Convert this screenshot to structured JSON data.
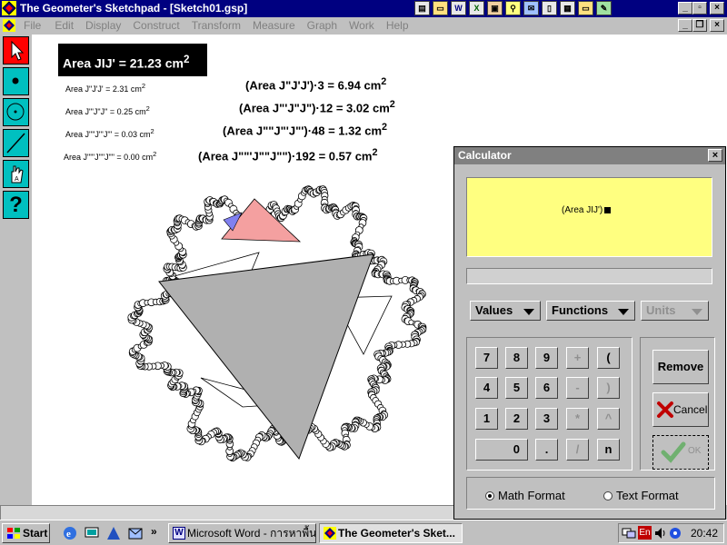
{
  "window": {
    "title": "The Geometer's Sketchpad - [Sketch01.gsp]"
  },
  "menubar": {
    "items": [
      "File",
      "Edit",
      "Display",
      "Construct",
      "Transform",
      "Measure",
      "Graph",
      "Work",
      "Help"
    ]
  },
  "toolbar_icons": [
    "notepad-icon",
    "open-folder-icon",
    "word-icon",
    "excel-icon",
    "powerpoint-icon",
    "search-icon",
    "mail-icon",
    "document-icon",
    "calculator-icon",
    "folder-icon",
    "paint-icon"
  ],
  "toolbox": {
    "tools": [
      "selection-arrow-tool-icon",
      "point-tool-icon",
      "compass-tool-icon",
      "straightedge-tool-icon",
      "text-hand-tool-icon",
      "help-tool-icon"
    ],
    "help_label": "?"
  },
  "measurements": {
    "main": {
      "label": "Area JIJ' = 21.23 cm",
      "sup": "2"
    },
    "small": [
      {
        "label": "Area J\"J'J' = 2.31 cm",
        "sup": "2"
      },
      {
        "label": "Area J\"'J\"J\" = 0.25 cm",
        "sup": "2"
      },
      {
        "label": "Area J\"\"J\"'J\"' = 0.03 cm",
        "sup": "2"
      },
      {
        "label": "Area J\"\"'J\"\"J\"\" = 0.00 cm",
        "sup": "2"
      }
    ],
    "computed": [
      {
        "label": "(Area J\"J'J')·3 = 6.94 cm",
        "sup": "2"
      },
      {
        "label": "(Area J\"'J\"J\")·12 = 3.02 cm",
        "sup": "2"
      },
      {
        "label": "(Area J\"\"J\"'J\"')·48 = 1.32 cm",
        "sup": "2"
      },
      {
        "label": "(Area J\"\"'J\"\"J\"\")·192 = 0.57 cm",
        "sup": "2"
      }
    ]
  },
  "calculator": {
    "title": "Calculator",
    "close_label": "×",
    "display_expression": "(Area JIJ')",
    "dropdowns": {
      "values": "Values",
      "functions": "Functions",
      "units": "Units"
    },
    "keys": [
      [
        "7",
        "8",
        "9",
        "+",
        "("
      ],
      [
        "4",
        "5",
        "6",
        "-",
        ")"
      ],
      [
        "1",
        "2",
        "3",
        "*",
        "^"
      ],
      [
        "0",
        ".",
        "/",
        "n"
      ]
    ],
    "buttons": {
      "remove": "Remove",
      "cancel": "Cancel",
      "ok": "OK"
    },
    "format": {
      "math": "Math Format",
      "text": "Text Format",
      "selected": "math"
    }
  },
  "taskbar": {
    "start_label": "Start",
    "quicklaunch": [
      "ie-icon",
      "desktop-icon",
      "channel-icon",
      "outlook-icon"
    ],
    "chevron": "»",
    "tasks": [
      {
        "label": "Microsoft Word - การหาพื้น...",
        "icon": "word-icon",
        "active": false
      },
      {
        "label": "The Geometer's Sket...",
        "icon": "sketchpad-icon",
        "active": true
      }
    ],
    "tray_language": "En",
    "clock": "20:42"
  },
  "colors": {
    "title_active": "#000080",
    "title_inactive": "#808080",
    "calculator_display": "#ffff80",
    "fill_gray": "#b0b0b0",
    "fill_pink": "#f4a0a0",
    "fill_blue": "#8080f0",
    "tool_selected": "#ff0000",
    "tool_normal": "#00c0c0"
  }
}
